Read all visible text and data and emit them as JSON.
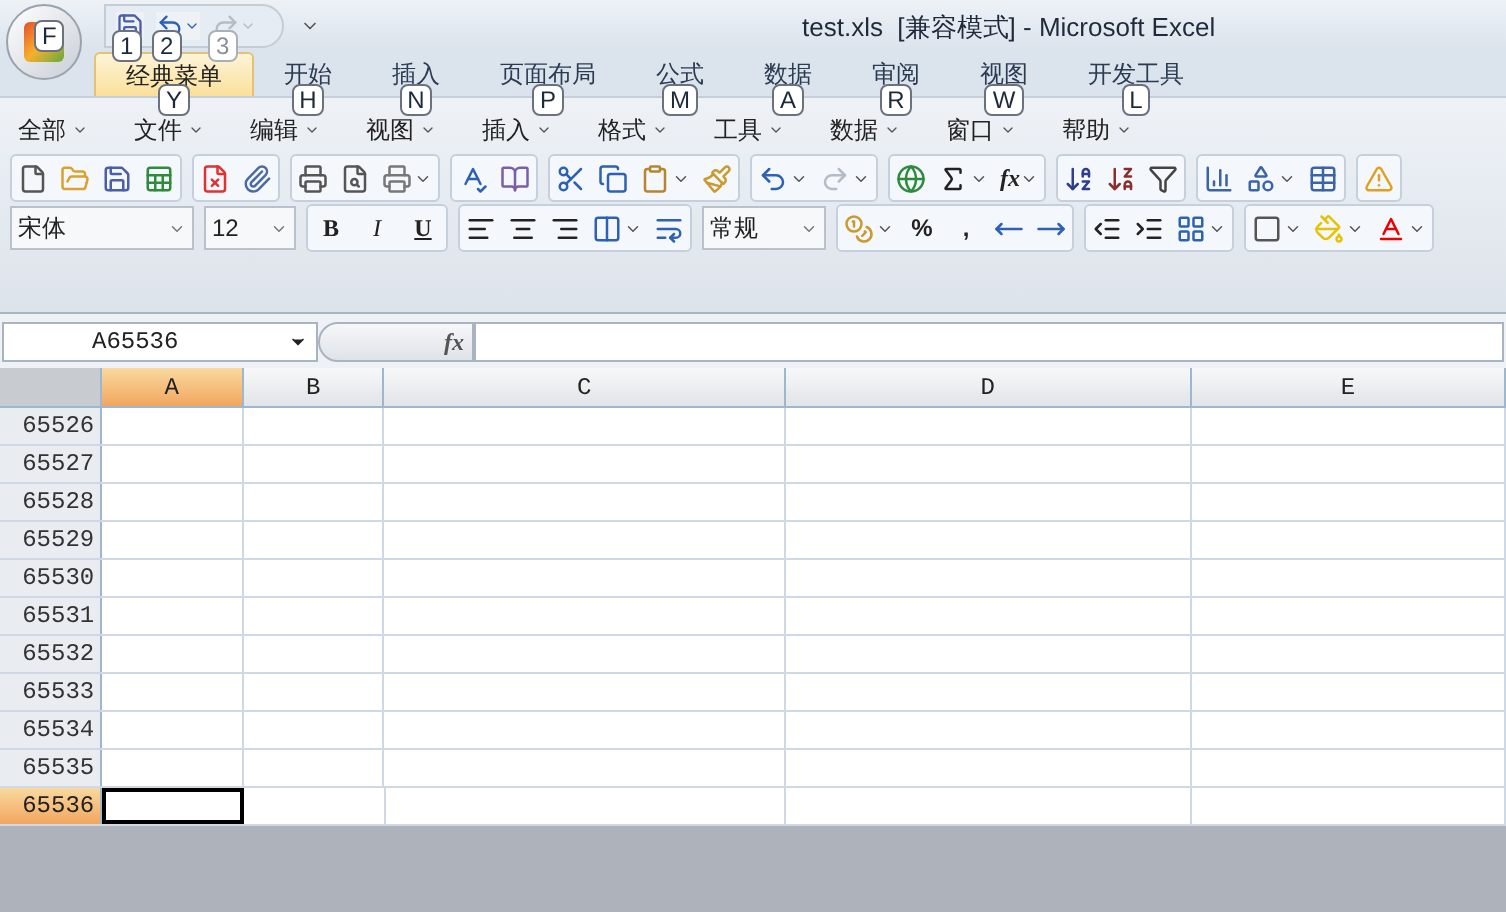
{
  "title_bar": {
    "title": "test.xls  [兼容模式] - Microsoft Excel",
    "office_keytip": "F",
    "quick_access": [
      {
        "kind": "save",
        "keytip": "1",
        "disabled": false
      },
      {
        "kind": "undo",
        "keytip": "2",
        "disabled": false
      },
      {
        "kind": "redo",
        "keytip": "3",
        "disabled": true
      }
    ]
  },
  "ribbon_tabs": [
    {
      "label": "经典菜单",
      "keytip": "Y",
      "selected": true
    },
    {
      "label": "开始",
      "keytip": "H",
      "selected": false
    },
    {
      "label": "插入",
      "keytip": "N",
      "selected": false
    },
    {
      "label": "页面布局",
      "keytip": "P",
      "selected": false
    },
    {
      "label": "公式",
      "keytip": "M",
      "selected": false
    },
    {
      "label": "数据",
      "keytip": "A",
      "selected": false
    },
    {
      "label": "审阅",
      "keytip": "R",
      "selected": false
    },
    {
      "label": "视图",
      "keytip": "W",
      "selected": false
    },
    {
      "label": "开发工具",
      "keytip": "L",
      "selected": false
    }
  ],
  "menu_bar": [
    "全部",
    "文件",
    "编辑",
    "视图",
    "插入",
    "格式",
    "工具",
    "数据",
    "窗口",
    "帮助"
  ],
  "toolbar": {
    "function_label": "fx",
    "font": "宋体",
    "font_size": "12",
    "format_buttons": [
      "B",
      "I",
      "U"
    ],
    "number_format": "常规",
    "number_buttons": [
      "%",
      ","
    ]
  },
  "formula_bar": {
    "name_box": "A65536",
    "fx_label": "fx"
  },
  "sheet": {
    "columns": [
      {
        "label": "A",
        "selected": true
      },
      {
        "label": "B",
        "selected": false
      },
      {
        "label": "C",
        "selected": false
      },
      {
        "label": "D",
        "selected": false
      },
      {
        "label": "E",
        "selected": false
      }
    ],
    "rows": [
      {
        "label": "65526",
        "selected": false
      },
      {
        "label": "65527",
        "selected": false
      },
      {
        "label": "65528",
        "selected": false
      },
      {
        "label": "65529",
        "selected": false
      },
      {
        "label": "65530",
        "selected": false
      },
      {
        "label": "65531",
        "selected": false
      },
      {
        "label": "65532",
        "selected": false
      },
      {
        "label": "65533",
        "selected": false
      },
      {
        "label": "65534",
        "selected": false
      },
      {
        "label": "65535",
        "selected": false
      },
      {
        "label": "65536",
        "selected": true
      }
    ]
  }
}
